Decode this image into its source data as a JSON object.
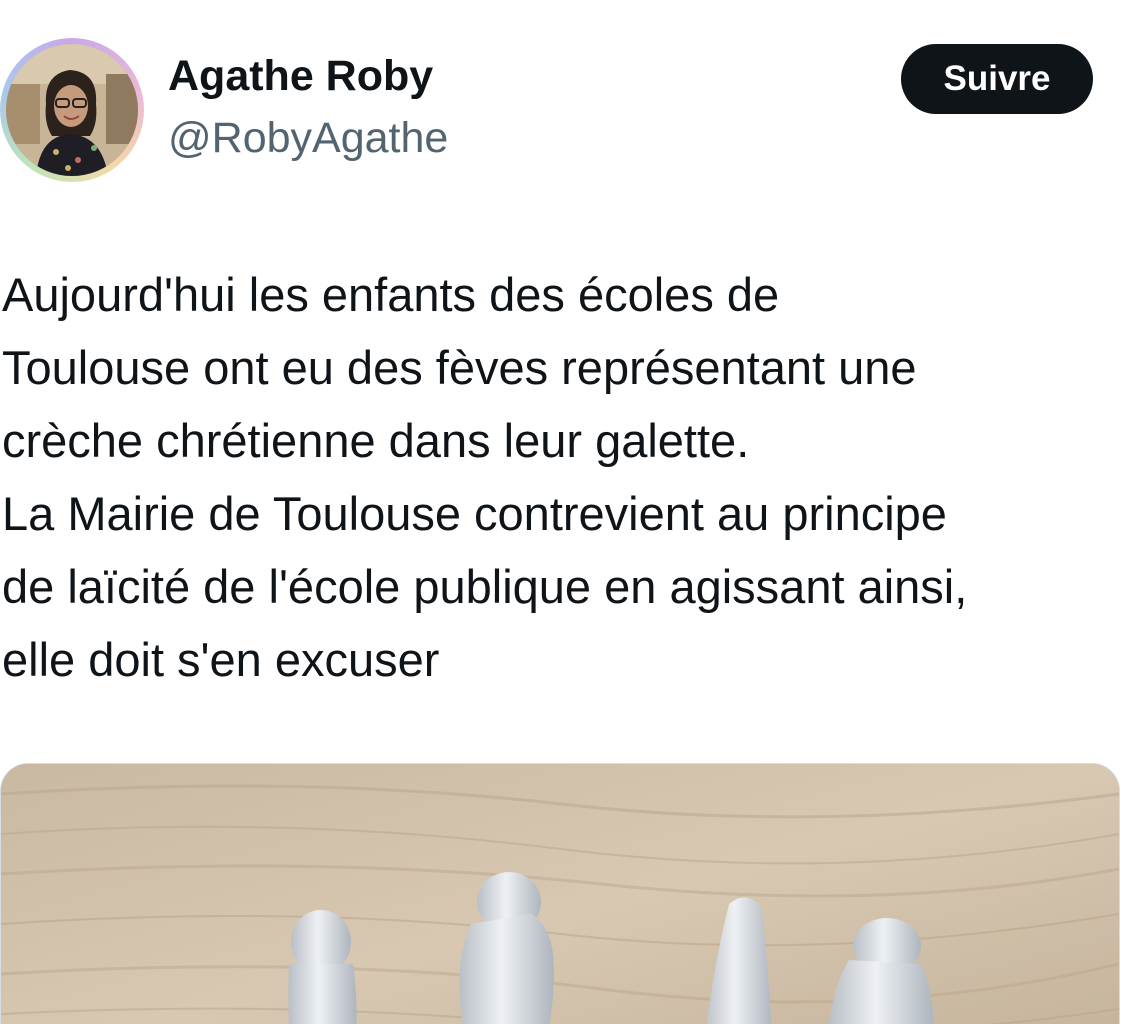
{
  "author": {
    "display_name": "Agathe Roby",
    "handle": "@RobyAgathe",
    "avatar_icon": "profile-photo"
  },
  "actions": {
    "follow_label": "Suivre"
  },
  "tweet": {
    "lines": [
      "Aujourd'hui les enfants des écoles de",
      "Toulouse ont eu des fèves représentant une",
      "crèche chrétienne dans leur galette.",
      "La Mairie de Toulouse contrevient au principe",
      "de laïcité de l'école publique en agissant ainsi,",
      "elle doit s'en excuser"
    ]
  },
  "media": {
    "subject": "photo-figurines-on-wooden-table"
  },
  "colors": {
    "text": "#0f1419",
    "secondary_text": "#536471",
    "follow_button_bg": "#0f1419",
    "follow_button_text": "#ffffff"
  }
}
